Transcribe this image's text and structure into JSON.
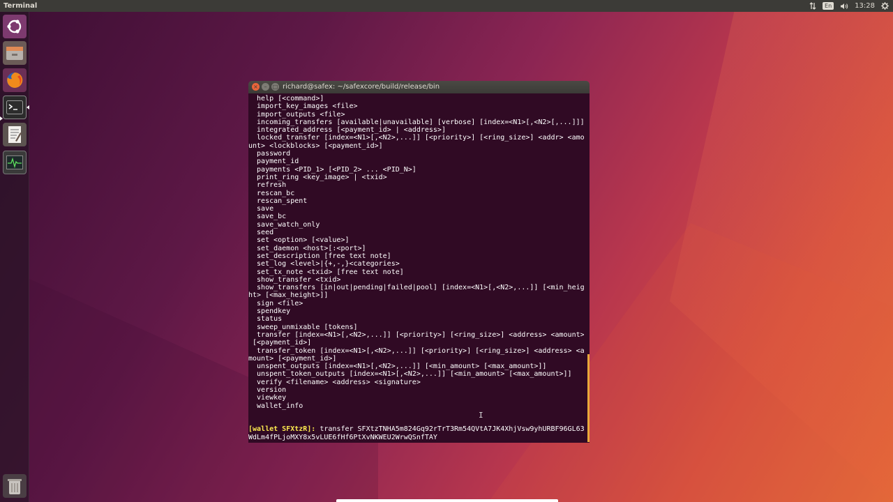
{
  "topbar": {
    "app_title": "Terminal",
    "kbd_layout": "En",
    "clock": "13:28",
    "tray_icons": [
      "network-updown-icon",
      "keyboard-layout-icon",
      "volume-icon",
      "power-gear-icon"
    ]
  },
  "launcher": {
    "items": [
      {
        "name": "ubuntu-dash-icon"
      },
      {
        "name": "files-icon"
      },
      {
        "name": "firefox-icon"
      },
      {
        "name": "terminal-icon"
      },
      {
        "name": "text-editor-icon"
      },
      {
        "name": "system-monitor-icon"
      },
      {
        "name": "trash-icon"
      }
    ]
  },
  "window": {
    "title": "richard@safex: ~/safexcore/build/release/bin",
    "close_glyph": "×",
    "min_glyph": "–",
    "max_glyph": "□"
  },
  "terminal": {
    "lines": [
      "  help [<command>]",
      "  import_key_images <file>",
      "  import_outputs <file>",
      "  incoming_transfers [available|unavailable] [verbose] [index=<N1>[,<N2>[,...]]]",
      "  integrated_address [<payment_id> | <address>]",
      "  locked_transfer [index=<N1>[,<N2>,...]] [<priority>] [<ring_size>] <addr> <amo",
      "unt> <lockblocks> [<payment_id>]",
      "  password",
      "  payment_id",
      "  payments <PID_1> [<PID_2> ... <PID_N>]",
      "  print_ring <key_image> | <txid>",
      "  refresh",
      "  rescan_bc",
      "  rescan_spent",
      "  save",
      "  save_bc",
      "  save_watch_only",
      "  seed",
      "  set <option> [<value>]",
      "  set_daemon <host>[:<port>]",
      "  set_description [free text note]",
      "  set_log <level>|{+,-,}<categories>",
      "  set_tx_note <txid> [free text note]",
      "  show_transfer <txid>",
      "  show_transfers [in|out|pending|failed|pool] [index=<N1>[,<N2>,...]] [<min_heig",
      "ht> [<max_height>]]",
      "  sign <file>",
      "  spendkey",
      "  status",
      "  sweep_unmixable [tokens]",
      "  transfer [index=<N1>[,<N2>,...]] [<priority>] [<ring_size>] <address> <amount>",
      " [<payment_id>]",
      "  transfer_token [index=<N1>[,<N2>,...]] [<priority>] [<ring_size>] <address> <a",
      "mount> [<payment_id>]",
      "  unspent_outputs [index=<N1>[,<N2>,...]] [<min_amount> [<max_amount>]]",
      "  unspent_token_outputs [index=<N1>[,<N2>,...]] [<min_amount> [<max_amount>]]",
      "  verify <filename> <address> <signature>",
      "  version",
      "  viewkey",
      "  wallet_info",
      "",
      ""
    ],
    "prompt": "[wallet SFXtzR]:",
    "command_line1": " transfer SFXtzTNHA5m824Gq92rTrT3Rm54QVtA7JK4XhjVsw9yhURBF96GL63",
    "command_line2": "WdLm4fPLjoMXY8x5vLUE6fHf6PtXvNKWEU2WrwQSnfTAY"
  }
}
